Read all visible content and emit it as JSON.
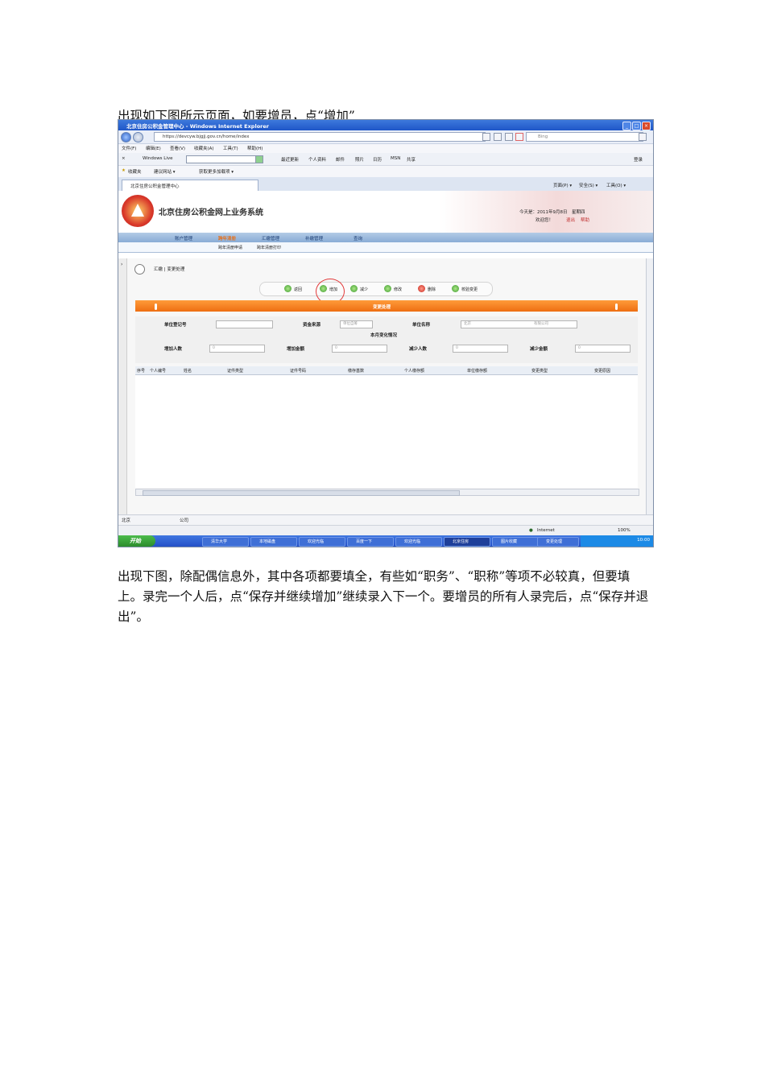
{
  "doc": {
    "para1": "出现如下图所示页面，如要增员，点“增加”",
    "para2": "出现下图，除配偶信息外，其中各项都要填全，有些如“职务”、“职称”等项不必较真，但要填上。录完一个人后，点“保存并继续增加”继续录入下一个。要增员的所有人录完后，点“保存并退出”。"
  },
  "browser": {
    "title": "北京住房公积金管理中心 - Windows Internet Explorer",
    "url": "https://devcyw.bjgjj.gov.cn/home/index",
    "search_placeholder": "Bing",
    "menu": [
      "文件(F)",
      "编辑(E)",
      "查看(V)",
      "收藏夹(A)",
      "工具(T)",
      "帮助(H)"
    ],
    "live_label": "Windows Live",
    "live_items": [
      "最近更新",
      "个人资料",
      "邮件",
      "照片",
      "日历",
      "MSN",
      "共享"
    ],
    "signin": "登录",
    "fav_items": [
      "收藏夹",
      "建议网站 ▾",
      "获取更多加载项 ▾"
    ],
    "tab_label": "北京住房公积金管理中心",
    "cmd_items": [
      "页面(P) ▾",
      "安全(S) ▾",
      "工具(O) ▾"
    ]
  },
  "site": {
    "system_name": "北京住房公积金网上业务系统",
    "date_line": "今天是：2011年9月8日　星期四",
    "welcome": "欢迎您！",
    "logout": "退出",
    "help": "帮助",
    "nav": [
      "账户管理",
      "跨年清册",
      "汇缴管理",
      "补缴管理",
      "查询"
    ],
    "subnav": [
      "跨年清册申请",
      "跨年清册打印"
    ],
    "breadcrumb": "汇缴 | 变更处理",
    "actions": [
      "返回",
      "增加",
      "减少",
      "修改",
      "删除",
      "校验变更"
    ],
    "section_title": "变更处理",
    "form": {
      "unit_reg_no": "单位登记号",
      "fund_source": "资金来源",
      "fund_source_value": "单位自筹",
      "unit_name": "单位名称",
      "unit_name_value": "北京",
      "unit_name_suffix": "有限公司",
      "month_change": "本月变化情况",
      "add_people": "增加人数",
      "add_amount": "增加金额",
      "reduce_people": "减少人数",
      "reduce_amount": "减少金额",
      "zero": "0"
    },
    "columns": [
      "序号",
      "个人编号",
      "姓名",
      "证件类型",
      "证件号码",
      "缴存基数",
      "个人缴存额",
      "单位缴存额",
      "变更类型",
      "变更原因"
    ],
    "status_left": "北京",
    "status_suffix": "公司"
  },
  "ie_status": {
    "zone": "Internet",
    "zoom": "100%"
  },
  "taskbar": {
    "start": "开始",
    "tasks": [
      "清华大学",
      "本地磁盘",
      "欢迎光临",
      "百度一下",
      "欢迎光临",
      "北京住房",
      "图片收藏",
      "变更处理"
    ],
    "clock": "10:00"
  }
}
